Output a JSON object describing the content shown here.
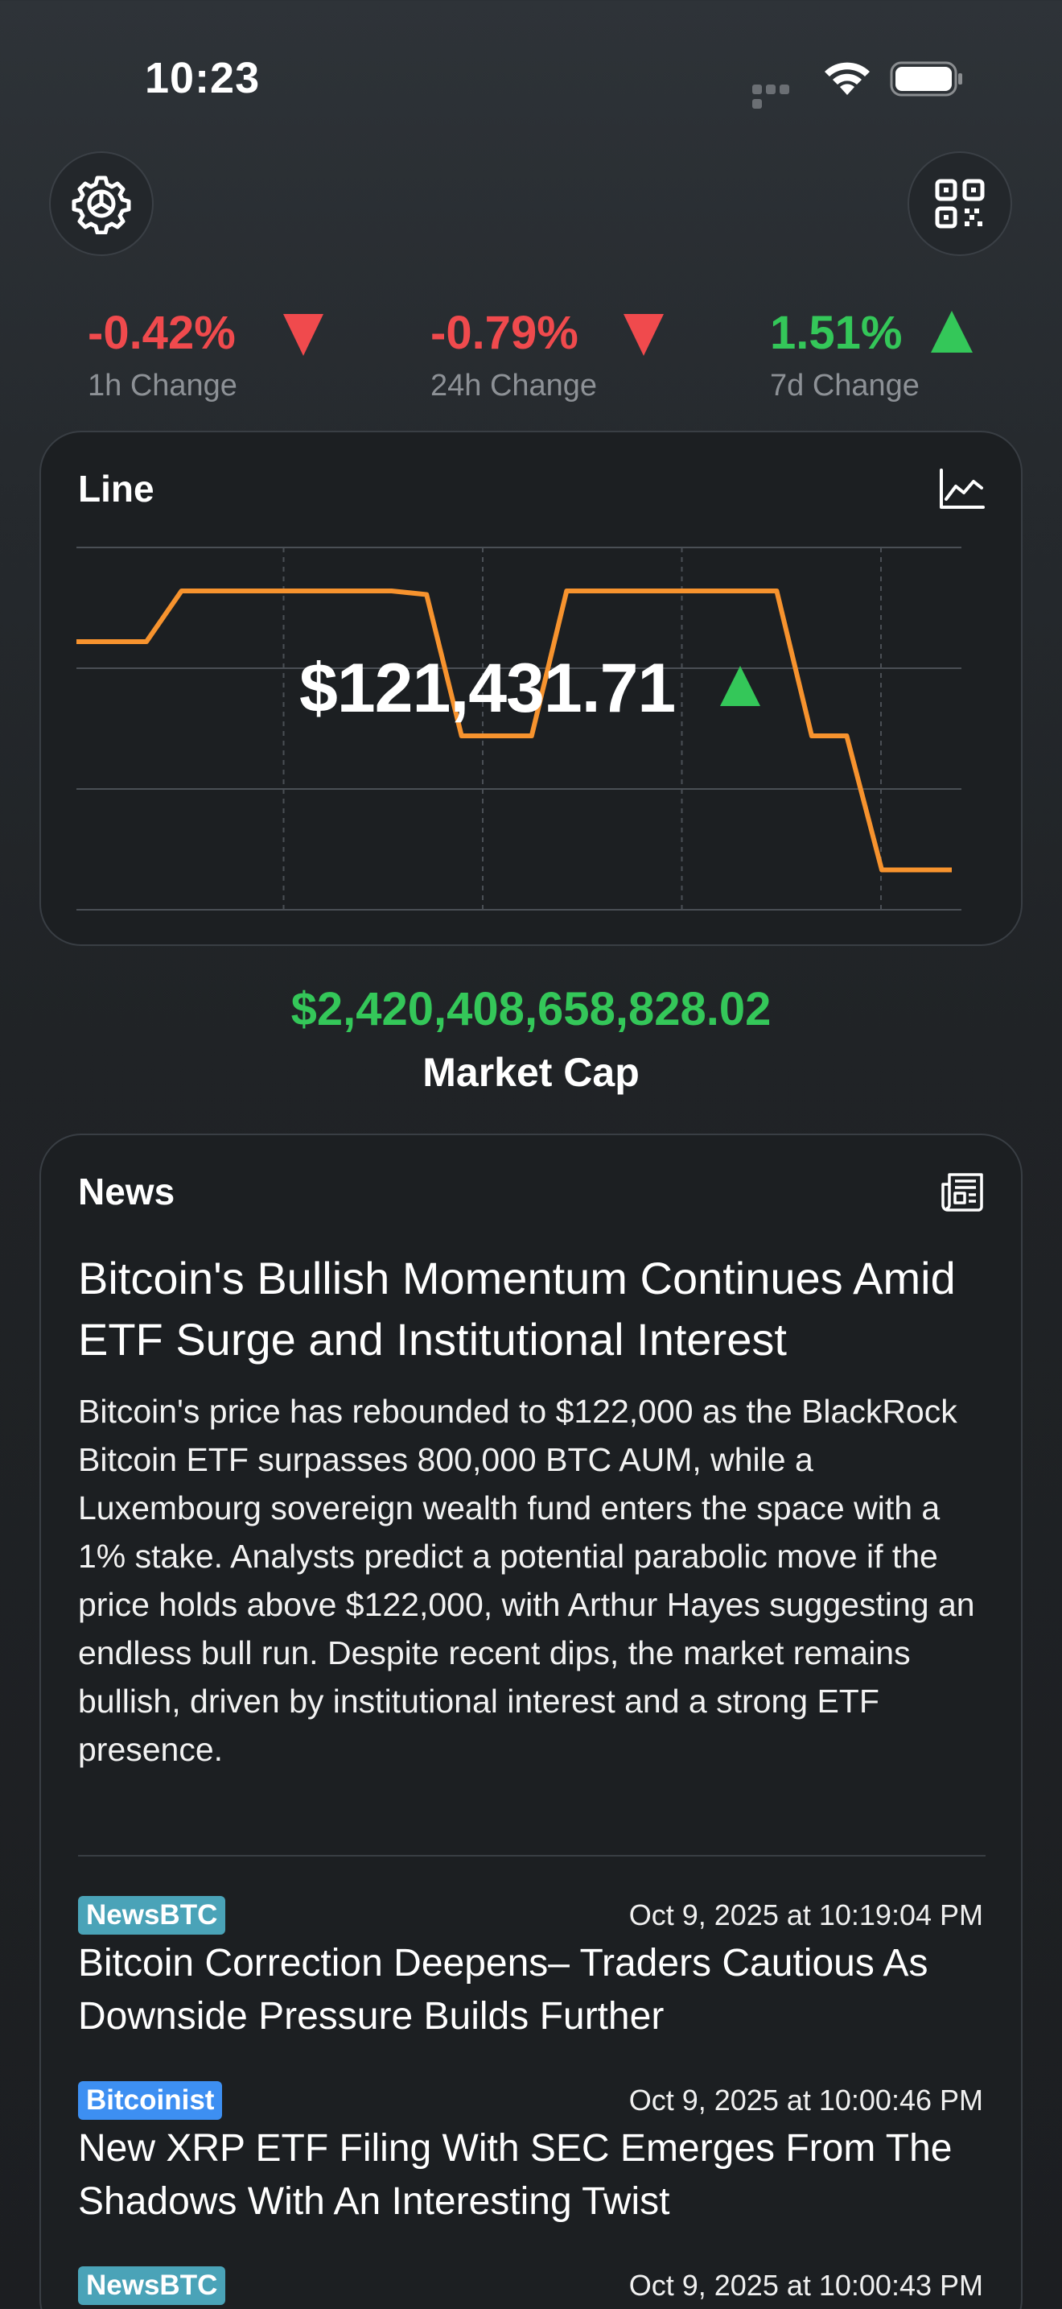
{
  "status_bar": {
    "time": "10:23"
  },
  "changes": [
    {
      "value": "-0.42%",
      "label": "1h Change",
      "direction": "down"
    },
    {
      "value": "-0.79%",
      "label": "24h Change",
      "direction": "down"
    },
    {
      "value": "1.51%",
      "label": "7d Change",
      "direction": "up"
    }
  ],
  "chart_card": {
    "title": "Line",
    "price": "$121,431.71",
    "price_direction": "up"
  },
  "chart_data": {
    "type": "line",
    "color": "#f7932e",
    "values": [
      0.74,
      0.74,
      0.74,
      0.88,
      0.88,
      0.88,
      0.88,
      0.88,
      0.88,
      0.88,
      0.87,
      0.48,
      0.48,
      0.48,
      0.88,
      0.88,
      0.88,
      0.88,
      0.88,
      0.88,
      0.88,
      0.48,
      0.48,
      0.11,
      0.11,
      0.11
    ],
    "grid": true
  },
  "market_cap": {
    "value": "$2,420,408,658,828.02",
    "label": "Market Cap"
  },
  "news": {
    "title": "News",
    "headline": "Bitcoin's Bullish Momentum Continues Amid ETF Surge and Institutional Interest",
    "summary": "Bitcoin's price has rebounded to $122,000 as the BlackRock Bitcoin ETF surpasses 800,000 BTC AUM, while a Luxembourg sovereign wealth fund enters the space with a 1% stake. Analysts predict a potential parabolic move if the price holds above $122,000, with Arthur Hayes suggesting an endless bull run. Despite recent dips, the market remains bullish, driven by institutional interest and a strong ETF presence.",
    "items": [
      {
        "source": "NewsBTC",
        "timestamp": "Oct 9, 2025 at 10:19:04 PM",
        "title": "Bitcoin Correction Deepens– Traders Cautious As Downside Pressure Builds Further"
      },
      {
        "source": "Bitcoinist",
        "timestamp": "Oct 9, 2025 at 10:00:46 PM",
        "title": "New XRP ETF Filing With SEC Emerges From The Shadows With An Interesting Twist"
      },
      {
        "source": "NewsBTC",
        "timestamp": "Oct 9, 2025 at 10:00:43 PM",
        "title": ""
      }
    ]
  },
  "icons": {
    "settings": "gear-icon",
    "qr": "qr-code-icon",
    "chart": "line-chart-icon",
    "news": "newspaper-icon"
  }
}
